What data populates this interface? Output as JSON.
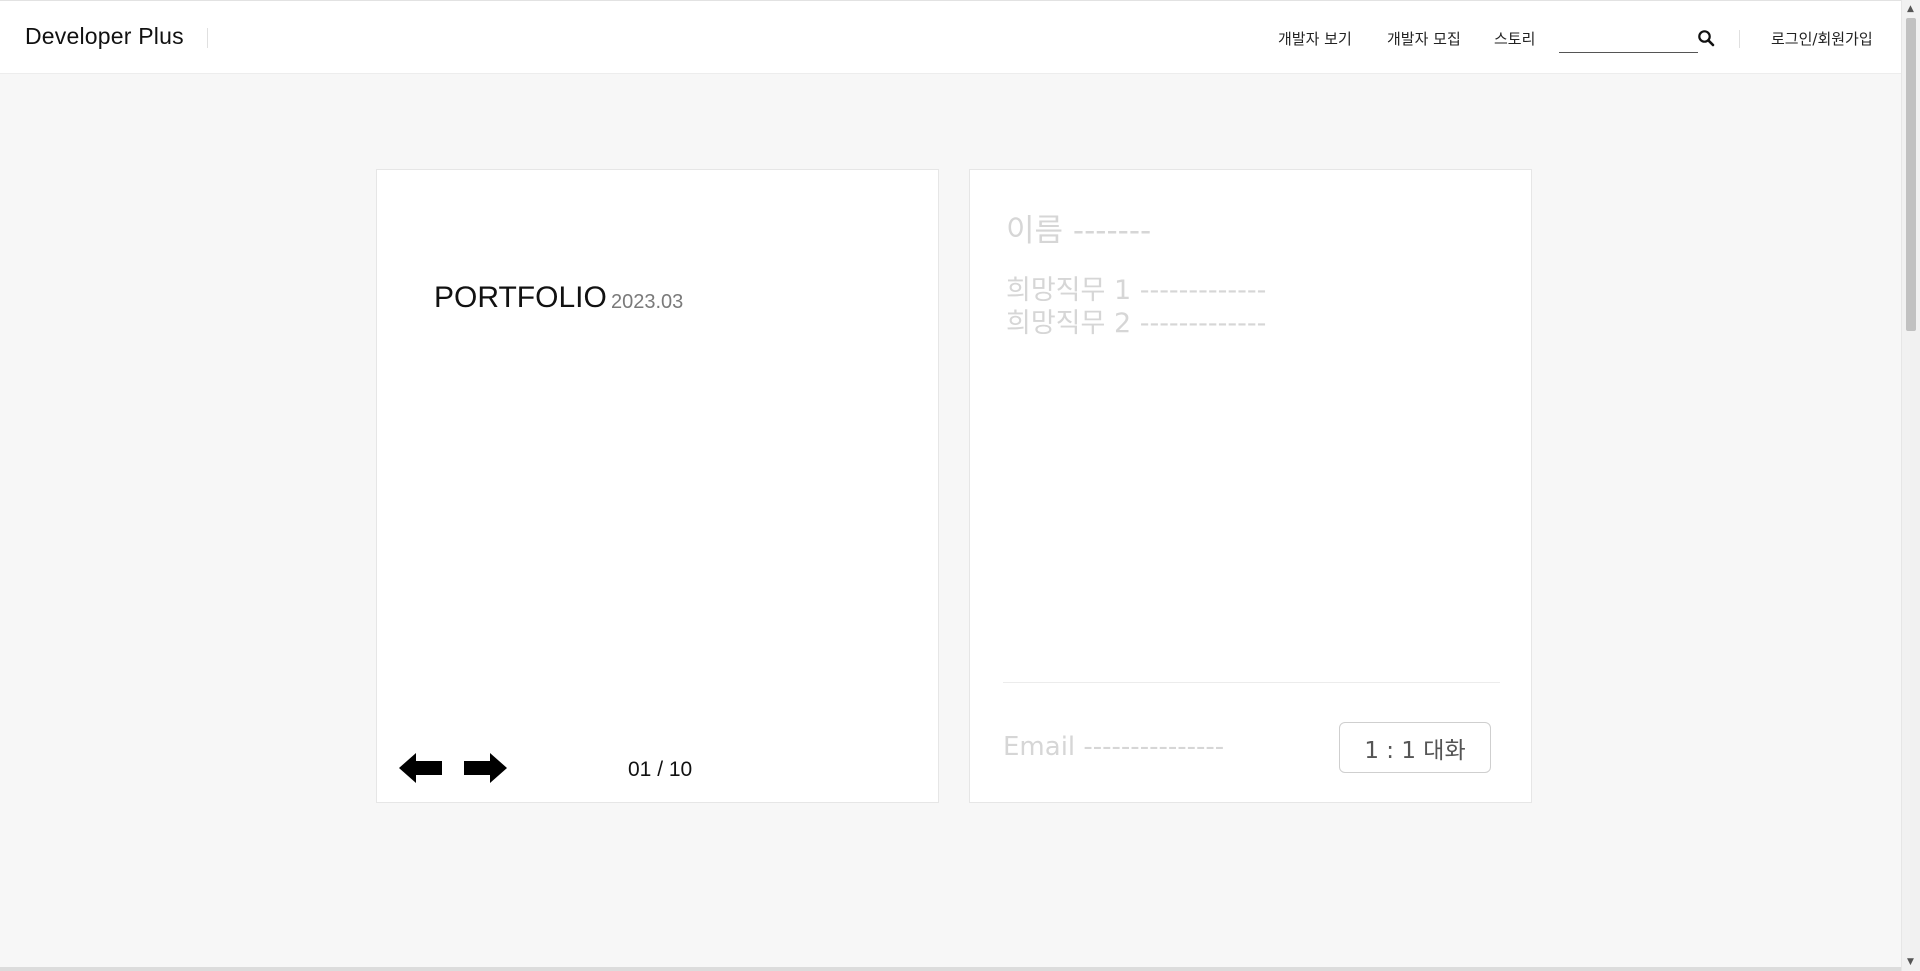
{
  "header": {
    "brand": "Developer Plus",
    "nav": [
      "개발자 보기",
      "개발자 모집",
      "스토리"
    ],
    "search": {
      "value": "",
      "placeholder": ""
    },
    "login": "로그인/회원가입"
  },
  "portfolio_card": {
    "title": "PORTFOLIO",
    "date": "2023.03",
    "page_counter": "01 / 10"
  },
  "profile_card": {
    "name": "이름 -------",
    "job1": "희망직무 1 -------------",
    "job2": "희망직무 2 -------------",
    "email": "Email ---------------",
    "chat_button": "1 : 1 대화"
  },
  "colors": {
    "background": "#f7f7f7",
    "card": "#ffffff",
    "placeholder_text": "#d6d6d6"
  },
  "icons": [
    "search-icon",
    "arrow-left-icon",
    "arrow-right-icon"
  ]
}
